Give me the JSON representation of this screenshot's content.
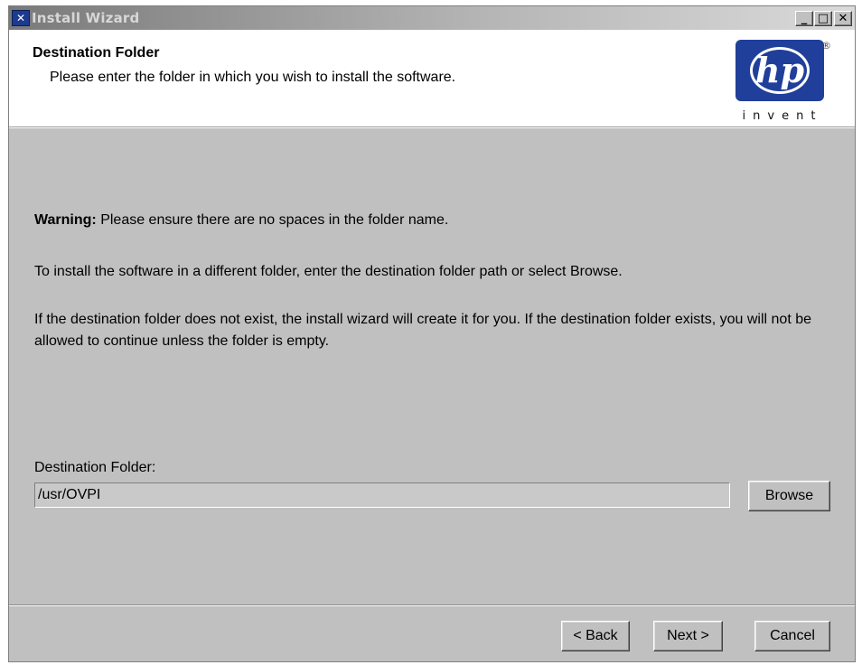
{
  "window": {
    "title": "Install Wizard",
    "app_icon_glyph": "✕",
    "controls": {
      "minimize": "_",
      "maximize": "□",
      "close": "✕"
    }
  },
  "header": {
    "title": "Destination Folder",
    "subtitle": "Please enter the folder in which you wish to install the software.",
    "logo": {
      "text": "hp",
      "tagline": "invent",
      "registered": "®",
      "color": "#1f3f9a"
    }
  },
  "body": {
    "warning_label": "Warning:",
    "warning_text": "Please ensure there are no spaces in the folder name.",
    "instruction": "To install the software in a different folder, enter the destination folder path or select Browse.",
    "note": "If the destination folder does not exist, the install wizard will create it for you. If the destination folder exists, you will not be allowed to continue unless the folder is empty."
  },
  "destination": {
    "label": "Destination Folder:",
    "value": "/usr/OVPI",
    "browse_label": "Browse"
  },
  "footer": {
    "back_label": "< Back",
    "next_label": "Next >",
    "cancel_label": "Cancel"
  }
}
